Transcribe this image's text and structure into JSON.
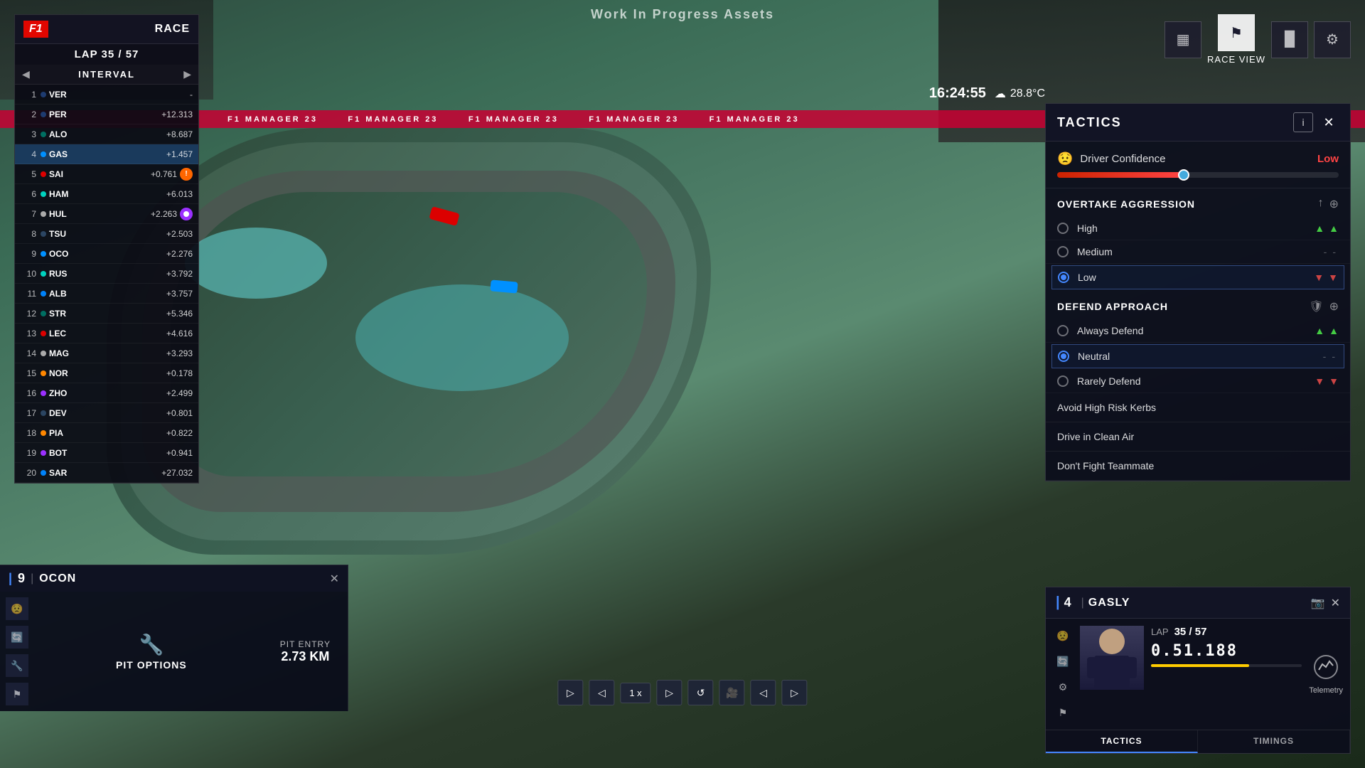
{
  "watermark": "Work In Progress Assets",
  "race": {
    "series": "F1",
    "mode": "RACE",
    "current_lap": 35,
    "total_laps": 57,
    "lap_display": "LAP 35 / 57",
    "interval_label": "INTERVAL"
  },
  "standings": [
    {
      "pos": 1,
      "abbr": "VER",
      "gap": "-",
      "team": "redbull"
    },
    {
      "pos": 2,
      "abbr": "PER",
      "gap": "+12.313",
      "team": "redbull"
    },
    {
      "pos": 3,
      "abbr": "ALO",
      "gap": "+8.687",
      "team": "aston"
    },
    {
      "pos": 4,
      "abbr": "GAS",
      "gap": "+1.457",
      "team": "alpine",
      "highlighted": true
    },
    {
      "pos": 5,
      "abbr": "SAI",
      "gap": "+0.761",
      "team": "ferrari",
      "alert": true
    },
    {
      "pos": 6,
      "abbr": "HAM",
      "gap": "+6.013",
      "team": "mercedes"
    },
    {
      "pos": 7,
      "abbr": "HUL",
      "gap": "+2.263",
      "team": "haas",
      "purple": true
    },
    {
      "pos": 8,
      "abbr": "TSU",
      "gap": "+2.503",
      "team": "alphatauri"
    },
    {
      "pos": 9,
      "abbr": "OCO",
      "gap": "+2.276",
      "team": "alpine"
    },
    {
      "pos": 10,
      "abbr": "RUS",
      "gap": "+3.792",
      "team": "mercedes"
    },
    {
      "pos": 11,
      "abbr": "ALB",
      "gap": "+3.757",
      "team": "williams"
    },
    {
      "pos": 12,
      "abbr": "STR",
      "gap": "+5.346",
      "team": "aston"
    },
    {
      "pos": 13,
      "abbr": "LEC",
      "gap": "+4.616",
      "team": "ferrari"
    },
    {
      "pos": 14,
      "abbr": "MAG",
      "gap": "+3.293",
      "team": "haas"
    },
    {
      "pos": 15,
      "abbr": "NOR",
      "gap": "+0.178",
      "team": "mclaren"
    },
    {
      "pos": 16,
      "abbr": "ZHO",
      "gap": "+2.499",
      "team": "alpha"
    },
    {
      "pos": 17,
      "abbr": "DEV",
      "gap": "+0.801",
      "team": "alphatauri"
    },
    {
      "pos": 18,
      "abbr": "PIA",
      "gap": "+0.822",
      "team": "mclaren"
    },
    {
      "pos": 19,
      "abbr": "BOT",
      "gap": "+0.941",
      "team": "alpha"
    },
    {
      "pos": 20,
      "abbr": "SAR",
      "gap": "+27.032",
      "team": "williams"
    }
  ],
  "top_right": {
    "race_view_label": "RACE VIEW",
    "controls": [
      {
        "id": "bar-chart",
        "symbol": "▦"
      },
      {
        "id": "flag-view",
        "symbol": "⚑",
        "active": true
      },
      {
        "id": "timing",
        "symbol": "▐▌"
      },
      {
        "id": "settings",
        "symbol": "⚙"
      }
    ]
  },
  "clock": {
    "time": "16:24:55",
    "weather_symbol": "☁",
    "temperature": "28.8°C"
  },
  "tactics": {
    "title": "TACTICS",
    "info_btn": "i",
    "close_btn": "✕",
    "driver_confidence": {
      "label": "Driver Confidence",
      "value_label": "Low",
      "slider_percent": 45
    },
    "overtake_aggression": {
      "title": "OVERTAKE AGGRESSION",
      "options": [
        {
          "label": "High",
          "selected": false
        },
        {
          "label": "Medium",
          "selected": false
        },
        {
          "label": "Low",
          "selected": true
        }
      ]
    },
    "defend_approach": {
      "title": "DEFEND APPROACH",
      "options": [
        {
          "label": "Always Defend",
          "selected": false
        },
        {
          "label": "Neutral",
          "selected": true
        },
        {
          "label": "Rarely Defend",
          "selected": false
        }
      ]
    },
    "toggles": [
      {
        "label": "Avoid High Risk Kerbs"
      },
      {
        "label": "Drive in Clean Air"
      },
      {
        "label": "Don't Fight Teammate"
      }
    ]
  },
  "driver_card": {
    "number": 4,
    "name": "GASLY",
    "camera_icon": "📷",
    "lap_label": "LAP",
    "lap_current": 35,
    "lap_total": 57,
    "lap_display": "35 / 57",
    "lap_time": "0.51.188",
    "bar_fill_percent": 65,
    "telemetry_label": "Telemetry",
    "tabs": [
      {
        "label": "TACTICS",
        "active": true
      },
      {
        "label": "TIMINGS",
        "active": false
      }
    ]
  },
  "ocon_panel": {
    "number": 9,
    "name": "OCON",
    "pit_entry_label": "PIT ENTRY",
    "pit_distance": "2.73 KM",
    "pit_options_label": "PIT OPTIONS"
  },
  "playback": {
    "speed_label": "1 x",
    "controls": [
      "◁◁",
      "◁",
      "▷",
      "▷▷"
    ]
  }
}
